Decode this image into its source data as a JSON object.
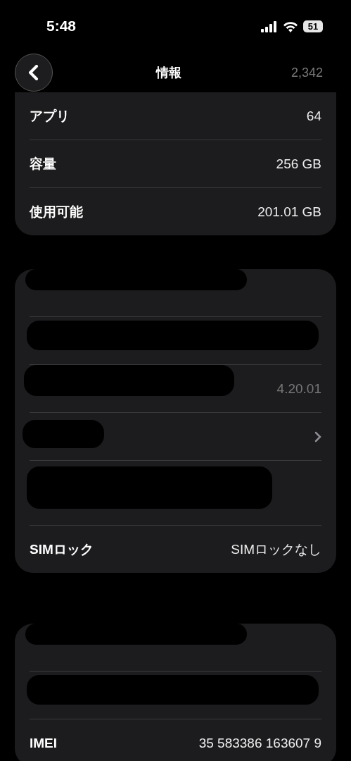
{
  "status_bar": {
    "time": "5:48",
    "battery": "51"
  },
  "nav": {
    "title": "情報",
    "behind_value": "2,342"
  },
  "sections": [
    {
      "rows": [
        {
          "kind": "text",
          "redacted": false,
          "label": "アプリ",
          "value": "64"
        },
        {
          "kind": "text",
          "redacted": false,
          "label": "容量",
          "value": "256 GB"
        },
        {
          "kind": "text",
          "redacted": false,
          "label": "使用可能",
          "value": "201.01 GB"
        }
      ]
    },
    {
      "rows": [
        {
          "kind": "text",
          "redacted": true
        },
        {
          "kind": "text",
          "redacted": true
        },
        {
          "kind": "text",
          "redacted": true,
          "value": "4.20.01"
        },
        {
          "kind": "link",
          "redacted": true
        },
        {
          "kind": "tall",
          "redacted": true
        },
        {
          "kind": "text",
          "redacted": false,
          "label": "SIMロック",
          "value": "SIMロックなし"
        }
      ]
    },
    {
      "rows": [
        {
          "kind": "text",
          "redacted": true
        },
        {
          "kind": "text",
          "redacted": true
        },
        {
          "kind": "text",
          "redacted": false,
          "label": "IMEI",
          "value": "35 583386 163607 9"
        }
      ]
    }
  ]
}
